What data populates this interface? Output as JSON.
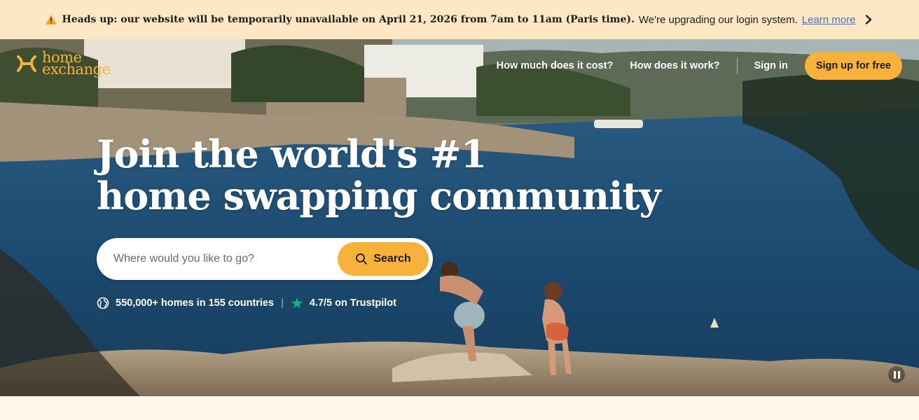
{
  "banner": {
    "bold_text": "Heads up: our website will be temporarily unavailable on April 21, 2026 from 7am to 11am (Paris time).",
    "normal_text": "We're upgrading our login system.",
    "link_text": "Learn more",
    "icon": "warning-icon"
  },
  "header": {
    "logo_line1": "home",
    "logo_line2": "exchange",
    "nav": {
      "cost": "How much does it cost?",
      "how": "How does it work?",
      "signin": "Sign in",
      "signup": "Sign up for free"
    }
  },
  "hero": {
    "headline_line1": "Join the world's #1",
    "headline_line2": "home swapping community",
    "search": {
      "placeholder": "Where would you like to go?",
      "button_label": "Search"
    },
    "stats": {
      "homes": "550,000+ homes in 155 countries",
      "separator": "|",
      "rating": "4.7/5 on Trustpilot"
    }
  },
  "colors": {
    "accent": "#f7b23b",
    "banner_bg": "#fde7c4",
    "trustpilot_star": "#00b67a",
    "link": "#3a73c9"
  }
}
